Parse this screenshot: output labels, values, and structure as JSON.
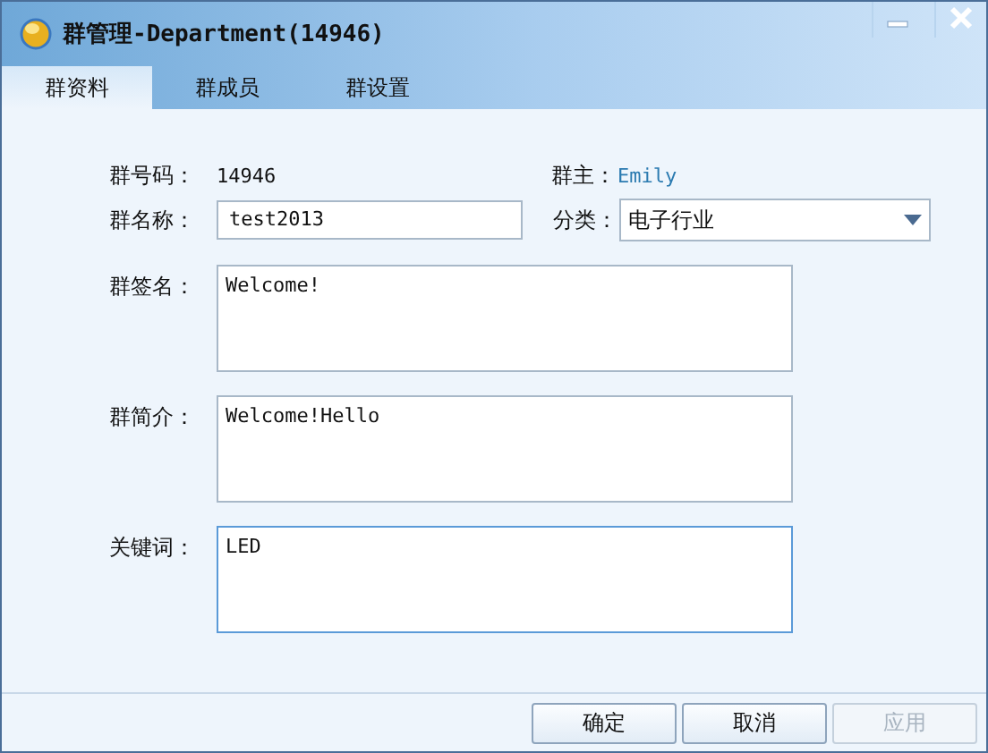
{
  "window": {
    "title": "群管理-Department(14946)"
  },
  "tabs": [
    {
      "label": "群资料",
      "selected": true
    },
    {
      "label": "群成员",
      "selected": false
    },
    {
      "label": "群设置",
      "selected": false
    }
  ],
  "info": {
    "number_label": "群号码：",
    "number": "14946",
    "owner_label": "群主：",
    "owner": "Emily"
  },
  "name_field": {
    "label": "群名称：",
    "value": "test2013"
  },
  "category": {
    "label": "分类：",
    "value": "电子行业"
  },
  "text_areas": [
    {
      "label": "群签名：",
      "value": "Welcome!",
      "focused": false
    },
    {
      "label": "群简介：",
      "value": "Welcome!Hello",
      "focused": false
    },
    {
      "label": "关键词：",
      "value": "LED",
      "focused": true
    }
  ],
  "buttons": [
    {
      "label": "确定",
      "disabled": false
    },
    {
      "label": "取消",
      "disabled": false
    },
    {
      "label": "应用",
      "disabled": true
    }
  ]
}
